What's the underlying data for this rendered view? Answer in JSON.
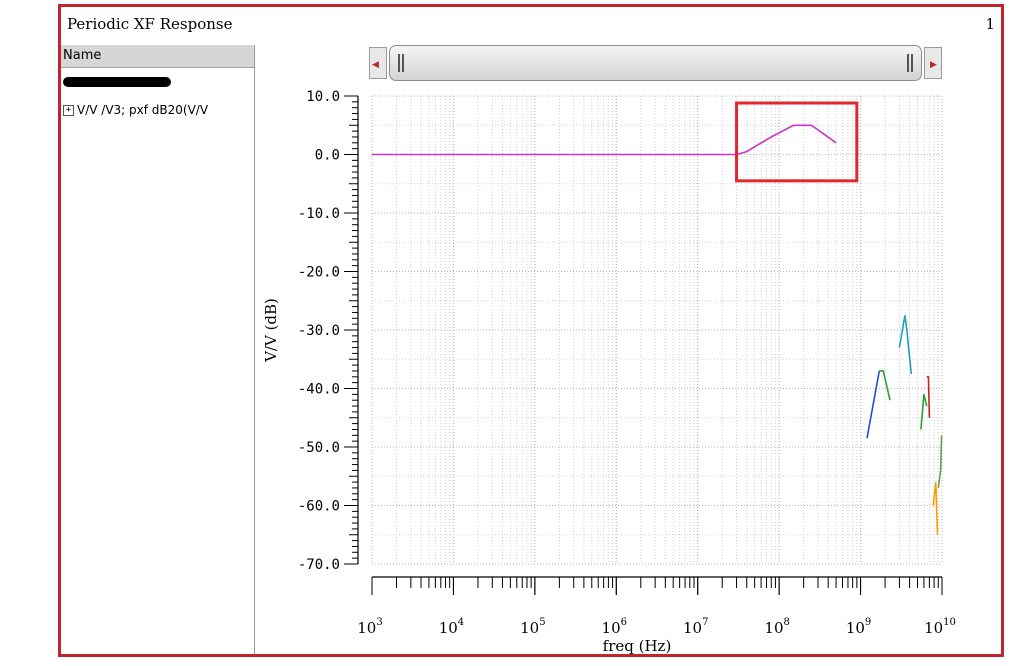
{
  "window": {
    "title": "Periodic XF Response",
    "page_number": "1"
  },
  "sidebar": {
    "header": "Name",
    "items": [
      {
        "expander": "+",
        "label": "V/V /V3; pxf dB20(V/V"
      }
    ]
  },
  "colors": {
    "frame": "#c0242c",
    "highlight_box": "#e0262e",
    "main_trace": "#cc33cc"
  },
  "chart_data": {
    "type": "line",
    "title": "",
    "xlabel": "freq (Hz)",
    "ylabel": "V/V (dB)",
    "x_scale": "log",
    "xlim": [
      1000,
      10000000000
    ],
    "ylim": [
      -70,
      10
    ],
    "y_ticks": [
      "10.0",
      "0.0",
      "-10.0",
      "-20.0",
      "-30.0",
      "-40.0",
      "-50.0",
      "-60.0",
      "-70.0"
    ],
    "x_ticks": [
      {
        "base": "10",
        "exp": "3"
      },
      {
        "base": "10",
        "exp": "4"
      },
      {
        "base": "10",
        "exp": "5"
      },
      {
        "base": "10",
        "exp": "6"
      },
      {
        "base": "10",
        "exp": "7"
      },
      {
        "base": "10",
        "exp": "8"
      },
      {
        "base": "10",
        "exp": "9"
      },
      {
        "base": "10",
        "exp": "10"
      }
    ],
    "grid": true,
    "series": [
      {
        "color": "#cc33cc",
        "x": [
          1000,
          30000000,
          40000000,
          80000000,
          150000000,
          250000000,
          500000000
        ],
        "y": [
          0,
          0,
          0.5,
          3,
          5,
          5,
          2
        ]
      },
      {
        "color": "#1f4fd6",
        "x": [
          1200000000,
          1700000000
        ],
        "y": [
          -48.5,
          -37
        ]
      },
      {
        "color": "#2ca02c",
        "x": [
          1700000000,
          1900000000,
          2300000000
        ],
        "y": [
          -37,
          -37,
          -42
        ]
      },
      {
        "color": "#1f9fbf",
        "x": [
          3000000000,
          3500000000,
          3700000000,
          4200000000
        ],
        "y": [
          -33,
          -27.5,
          -30,
          -37.5
        ]
      },
      {
        "color": "#2ca02c",
        "x": [
          5500000000,
          6000000000,
          6500000000
        ],
        "y": [
          -47,
          -41,
          -43
        ]
      },
      {
        "color": "#cc2222",
        "x": [
          6500000000,
          6800000000,
          7000000000
        ],
        "y": [
          -38,
          -38,
          -45
        ]
      },
      {
        "color": "#ff9900",
        "x": [
          7800000000,
          8400000000,
          8800000000
        ],
        "y": [
          -60,
          -56,
          -65
        ]
      },
      {
        "color": "#6aa04a",
        "x": [
          9000000000,
          9600000000,
          9900000000
        ],
        "y": [
          -57,
          -54,
          -48
        ]
      }
    ],
    "highlight": {
      "x_range": [
        30000000,
        900000000
      ],
      "y_range": [
        -4.5,
        8.8
      ]
    }
  }
}
